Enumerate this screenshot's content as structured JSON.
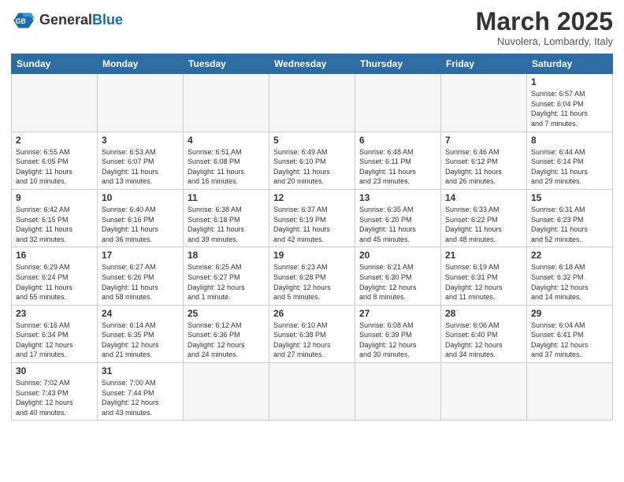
{
  "header": {
    "logo_general": "General",
    "logo_blue": "Blue",
    "month": "March 2025",
    "location": "Nuvolera, Lombardy, Italy"
  },
  "weekdays": [
    "Sunday",
    "Monday",
    "Tuesday",
    "Wednesday",
    "Thursday",
    "Friday",
    "Saturday"
  ],
  "weeks": [
    [
      {
        "day": "",
        "info": ""
      },
      {
        "day": "",
        "info": ""
      },
      {
        "day": "",
        "info": ""
      },
      {
        "day": "",
        "info": ""
      },
      {
        "day": "",
        "info": ""
      },
      {
        "day": "",
        "info": ""
      },
      {
        "day": "1",
        "info": "Sunrise: 6:57 AM\nSunset: 6:04 PM\nDaylight: 11 hours\nand 7 minutes."
      }
    ],
    [
      {
        "day": "2",
        "info": "Sunrise: 6:55 AM\nSunset: 6:05 PM\nDaylight: 11 hours\nand 10 minutes."
      },
      {
        "day": "3",
        "info": "Sunrise: 6:53 AM\nSunset: 6:07 PM\nDaylight: 11 hours\nand 13 minutes."
      },
      {
        "day": "4",
        "info": "Sunrise: 6:51 AM\nSunset: 6:08 PM\nDaylight: 11 hours\nand 16 minutes."
      },
      {
        "day": "5",
        "info": "Sunrise: 6:49 AM\nSunset: 6:10 PM\nDaylight: 11 hours\nand 20 minutes."
      },
      {
        "day": "6",
        "info": "Sunrise: 6:48 AM\nSunset: 6:11 PM\nDaylight: 11 hours\nand 23 minutes."
      },
      {
        "day": "7",
        "info": "Sunrise: 6:46 AM\nSunset: 6:12 PM\nDaylight: 11 hours\nand 26 minutes."
      },
      {
        "day": "8",
        "info": "Sunrise: 6:44 AM\nSunset: 6:14 PM\nDaylight: 11 hours\nand 29 minutes."
      }
    ],
    [
      {
        "day": "9",
        "info": "Sunrise: 6:42 AM\nSunset: 6:15 PM\nDaylight: 11 hours\nand 32 minutes."
      },
      {
        "day": "10",
        "info": "Sunrise: 6:40 AM\nSunset: 6:16 PM\nDaylight: 11 hours\nand 36 minutes."
      },
      {
        "day": "11",
        "info": "Sunrise: 6:38 AM\nSunset: 6:18 PM\nDaylight: 11 hours\nand 39 minutes."
      },
      {
        "day": "12",
        "info": "Sunrise: 6:37 AM\nSunset: 6:19 PM\nDaylight: 11 hours\nand 42 minutes."
      },
      {
        "day": "13",
        "info": "Sunrise: 6:35 AM\nSunset: 6:20 PM\nDaylight: 11 hours\nand 45 minutes."
      },
      {
        "day": "14",
        "info": "Sunrise: 6:33 AM\nSunset: 6:22 PM\nDaylight: 11 hours\nand 48 minutes."
      },
      {
        "day": "15",
        "info": "Sunrise: 6:31 AM\nSunset: 6:23 PM\nDaylight: 11 hours\nand 52 minutes."
      }
    ],
    [
      {
        "day": "16",
        "info": "Sunrise: 6:29 AM\nSunset: 6:24 PM\nDaylight: 11 hours\nand 55 minutes."
      },
      {
        "day": "17",
        "info": "Sunrise: 6:27 AM\nSunset: 6:26 PM\nDaylight: 11 hours\nand 58 minutes."
      },
      {
        "day": "18",
        "info": "Sunrise: 6:25 AM\nSunset: 6:27 PM\nDaylight: 12 hours\nand 1 minute."
      },
      {
        "day": "19",
        "info": "Sunrise: 6:23 AM\nSunset: 6:28 PM\nDaylight: 12 hours\nand 5 minutes."
      },
      {
        "day": "20",
        "info": "Sunrise: 6:21 AM\nSunset: 6:30 PM\nDaylight: 12 hours\nand 8 minutes."
      },
      {
        "day": "21",
        "info": "Sunrise: 6:19 AM\nSunset: 6:31 PM\nDaylight: 12 hours\nand 11 minutes."
      },
      {
        "day": "22",
        "info": "Sunrise: 6:18 AM\nSunset: 6:32 PM\nDaylight: 12 hours\nand 14 minutes."
      }
    ],
    [
      {
        "day": "23",
        "info": "Sunrise: 6:16 AM\nSunset: 6:34 PM\nDaylight: 12 hours\nand 17 minutes."
      },
      {
        "day": "24",
        "info": "Sunrise: 6:14 AM\nSunset: 6:35 PM\nDaylight: 12 hours\nand 21 minutes."
      },
      {
        "day": "25",
        "info": "Sunrise: 6:12 AM\nSunset: 6:36 PM\nDaylight: 12 hours\nand 24 minutes."
      },
      {
        "day": "26",
        "info": "Sunrise: 6:10 AM\nSunset: 6:38 PM\nDaylight: 12 hours\nand 27 minutes."
      },
      {
        "day": "27",
        "info": "Sunrise: 6:08 AM\nSunset: 6:39 PM\nDaylight: 12 hours\nand 30 minutes."
      },
      {
        "day": "28",
        "info": "Sunrise: 6:06 AM\nSunset: 6:40 PM\nDaylight: 12 hours\nand 34 minutes."
      },
      {
        "day": "29",
        "info": "Sunrise: 6:04 AM\nSunset: 6:41 PM\nDaylight: 12 hours\nand 37 minutes."
      }
    ],
    [
      {
        "day": "30",
        "info": "Sunrise: 7:02 AM\nSunset: 7:43 PM\nDaylight: 12 hours\nand 40 minutes."
      },
      {
        "day": "31",
        "info": "Sunrise: 7:00 AM\nSunset: 7:44 PM\nDaylight: 12 hours\nand 43 minutes."
      },
      {
        "day": "",
        "info": ""
      },
      {
        "day": "",
        "info": ""
      },
      {
        "day": "",
        "info": ""
      },
      {
        "day": "",
        "info": ""
      },
      {
        "day": "",
        "info": ""
      }
    ]
  ]
}
